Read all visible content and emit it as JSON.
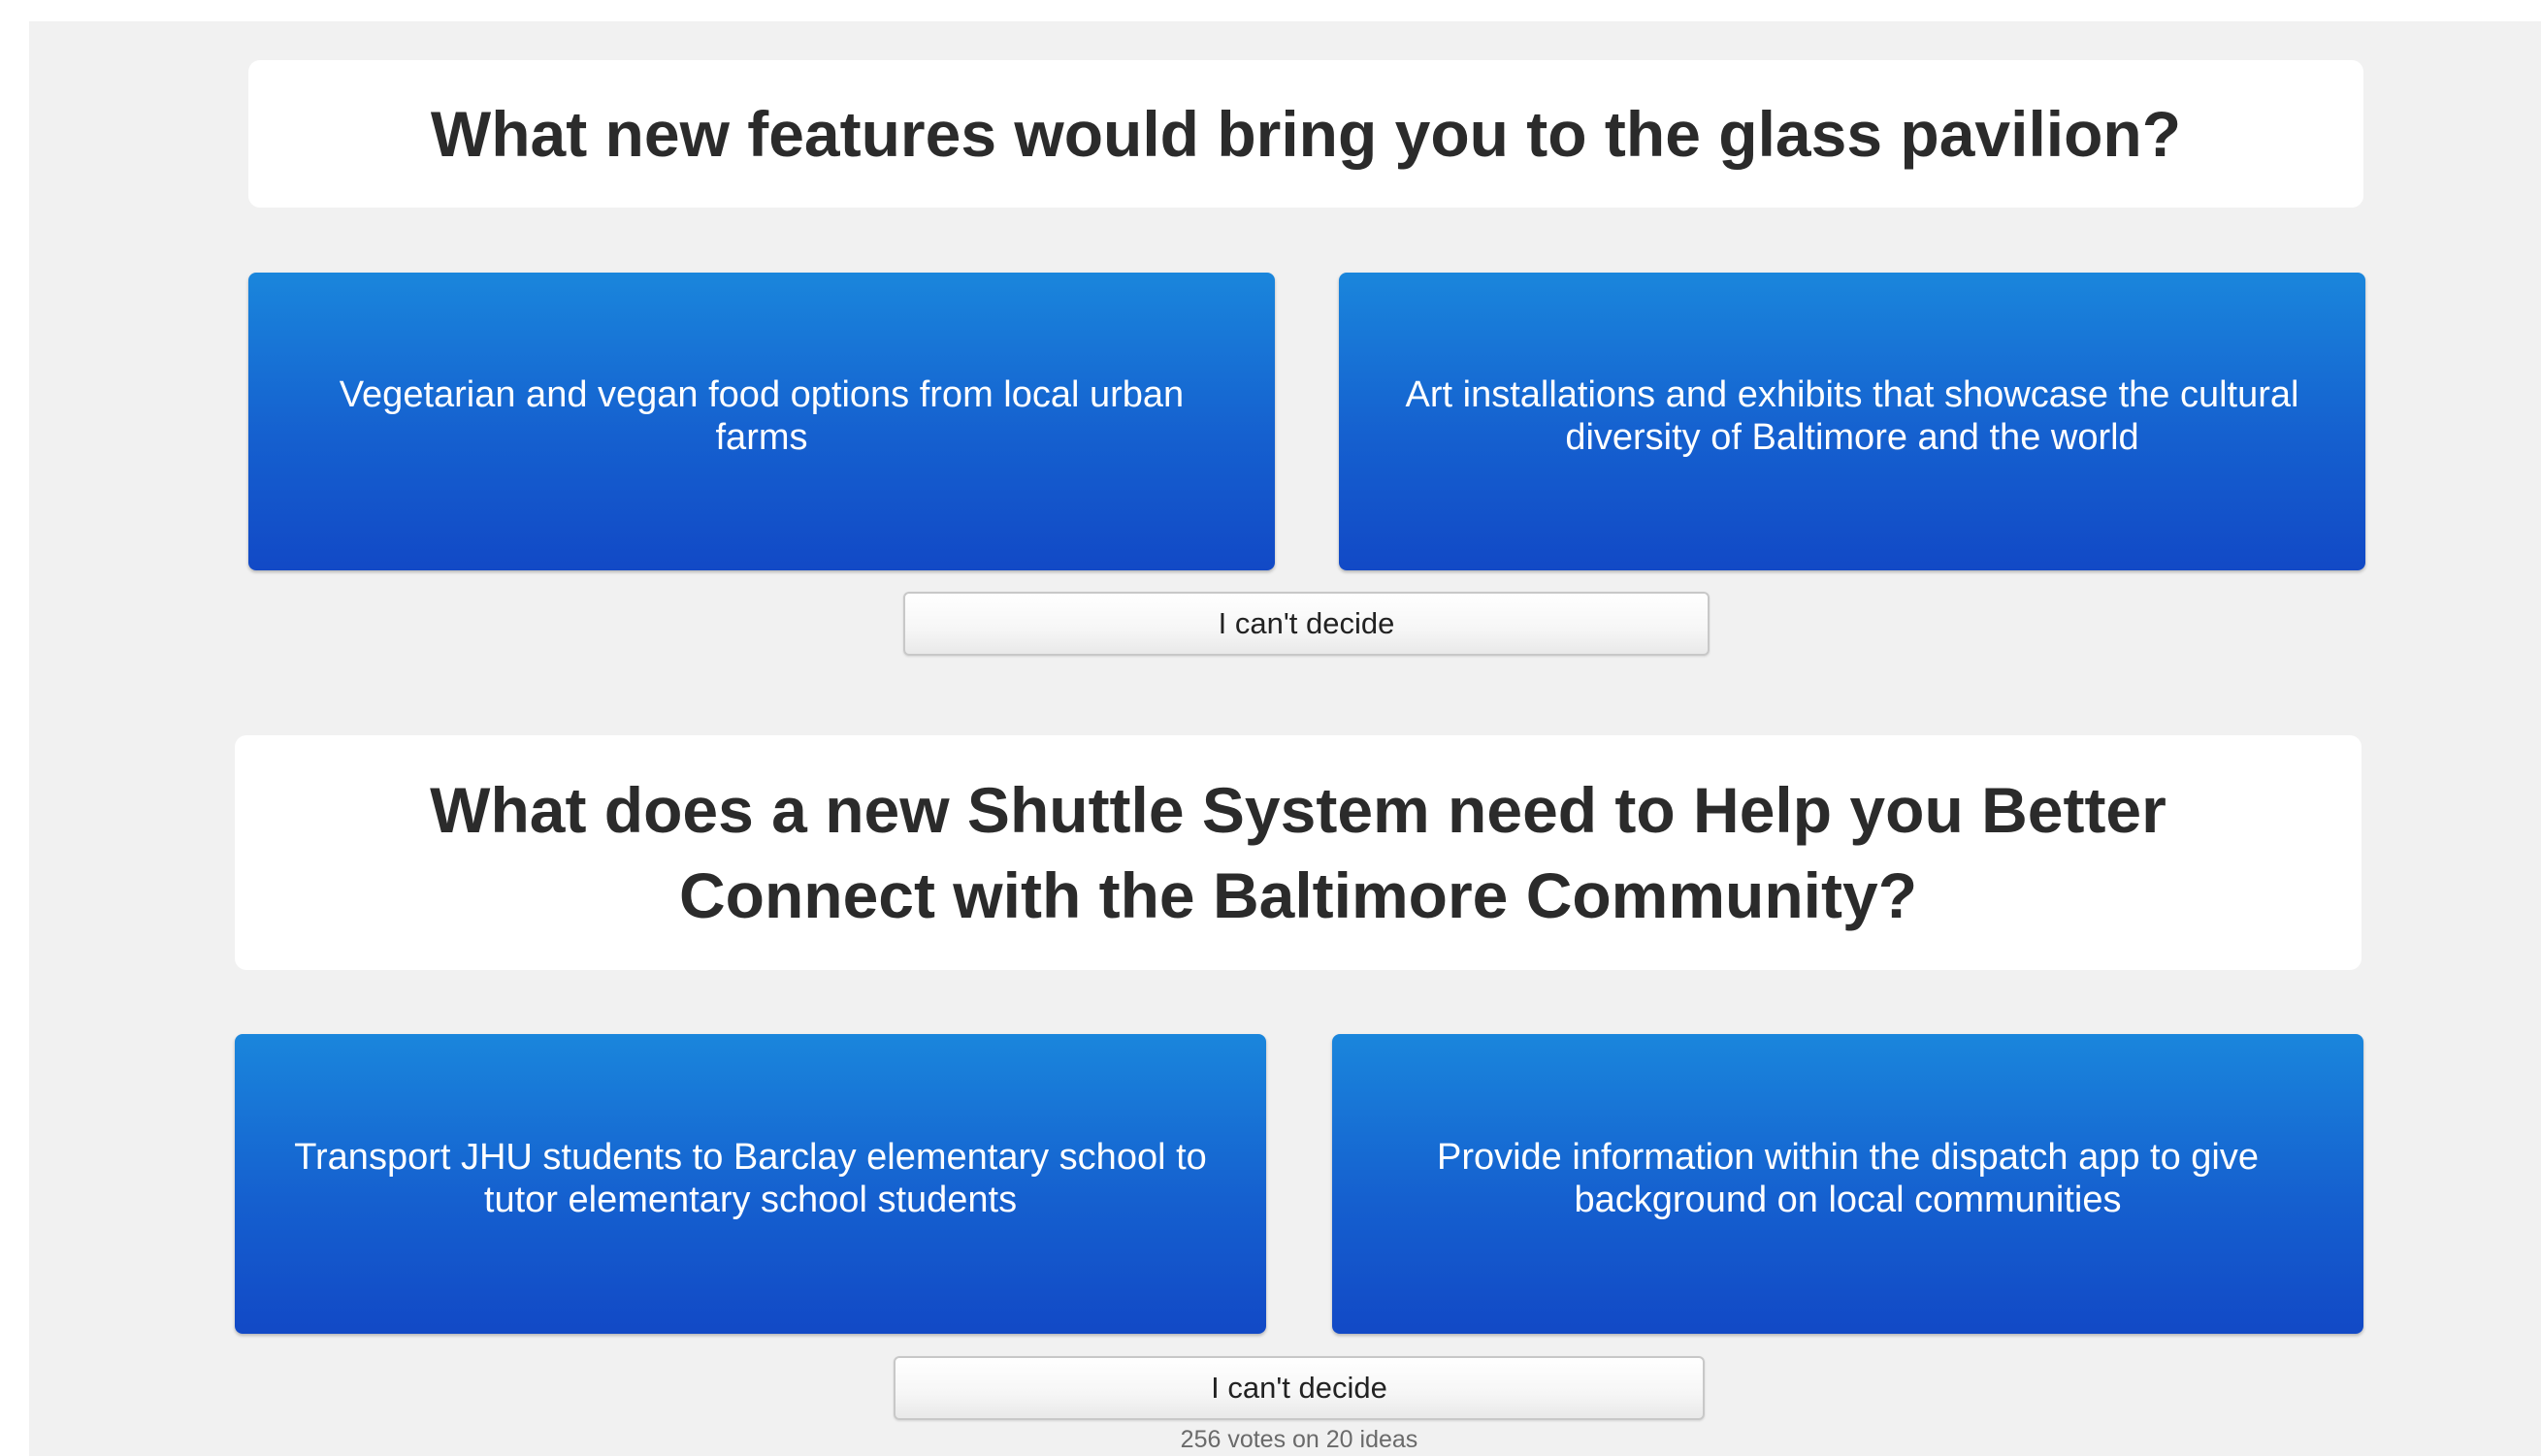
{
  "questions": [
    {
      "title": "What new features would bring you to the glass pavilion?",
      "left_choice": "Vegetarian and vegan food options from local urban farms",
      "right_choice": "Art installations and exhibits that showcase the cultural diversity of Baltimore and the world",
      "cant_decide_label": "I can't decide"
    },
    {
      "title": "What does a new Shuttle System need to Help you Better Connect with the Baltimore Community?",
      "left_choice": "Transport JHU students to Barclay elementary school to tutor elementary school students",
      "right_choice": "Provide information within the dispatch app to give background on local communities",
      "cant_decide_label": "I can't decide",
      "vote_summary": "256 votes on 20 ideas"
    }
  ],
  "colors": {
    "choice_top": "#1a86dc",
    "choice_bottom": "#1249c6",
    "title_text": "#2b2b2b",
    "background": "#f1f1f1"
  }
}
